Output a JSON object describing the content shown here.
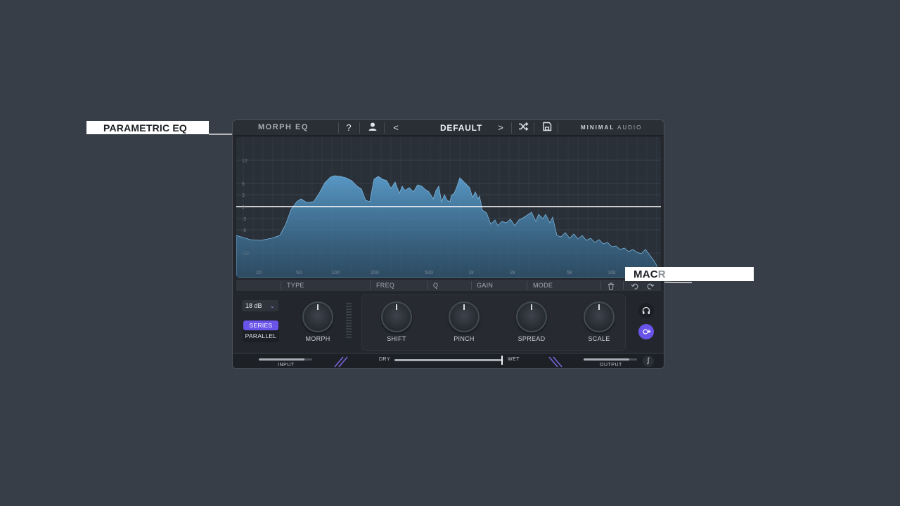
{
  "callouts": {
    "parametric_eq": "PARAMETRIC EQ",
    "macro_prefix": "MAC",
    "macro_faded": "R"
  },
  "plugin": {
    "title": "MORPH EQ",
    "help_icon": "?",
    "preset_name": "DEFAULT",
    "prev_icon": "<",
    "next_icon": ">",
    "brand_bold": "MINIMAL",
    "brand_light": "AUDIO"
  },
  "eq": {
    "db_labels": [
      "12",
      "6",
      "3",
      "0",
      "-3",
      "-6",
      "-12"
    ],
    "freq_labels": [
      "20",
      "50",
      "100",
      "200",
      "500",
      "1k",
      "2k",
      "5k",
      "10k"
    ]
  },
  "param_bar": {
    "type": "TYPE",
    "freq": "FREQ",
    "q": "Q",
    "gain": "GAIN",
    "mode": "MODE"
  },
  "controls": {
    "slope": "18 dB",
    "series": "SERIES",
    "parallel": "PARALLEL",
    "morph": "MORPH",
    "shift": "SHIFT",
    "pinch": "PINCH",
    "spread": "SPREAD",
    "scale": "SCALE"
  },
  "bottom": {
    "input": "INPUT",
    "dry": "DRY",
    "wet": "WET",
    "output": "OUTPUT",
    "dry_wet_level": 0.98,
    "input_level": 0.85,
    "output_level": 0.85
  },
  "colors": {
    "accent": "#6a53e8",
    "spectrum": "#4f8fc0",
    "background": "#383e47"
  },
  "icons": {
    "user": "user-icon",
    "shuffle": "shuffle-icon",
    "save": "save-icon",
    "trash": "trash-icon",
    "undo": "undo-icon",
    "redo": "redo-icon",
    "headphones": "headphones-icon",
    "add_node": "add-node-icon",
    "curve": "curve-icon"
  }
}
